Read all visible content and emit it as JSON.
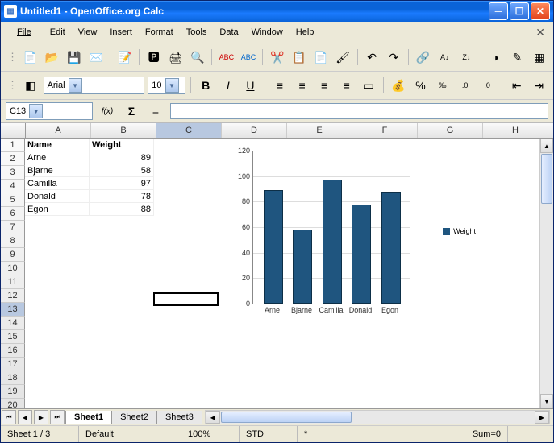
{
  "title": "Untitled1 - OpenOffice.org Calc",
  "menus": [
    "File",
    "Edit",
    "View",
    "Insert",
    "Format",
    "Tools",
    "Data",
    "Window",
    "Help"
  ],
  "font": {
    "name": "Arial",
    "size": "10"
  },
  "namebox": "C13",
  "formula_eq": "=",
  "columns": [
    "A",
    "B",
    "C",
    "D",
    "E",
    "F",
    "G",
    "H"
  ],
  "row_count": 22,
  "selected": {
    "row": 13,
    "col": 3
  },
  "table": {
    "headers": {
      "A": "Name",
      "B": "Weight"
    },
    "rows": [
      {
        "A": "Arne",
        "B": 89
      },
      {
        "A": "Bjarne",
        "B": 58
      },
      {
        "A": "Camilla",
        "B": 97
      },
      {
        "A": "Donald",
        "B": 78
      },
      {
        "A": "Egon",
        "B": 88
      }
    ]
  },
  "sheets": [
    "Sheet1",
    "Sheet2",
    "Sheet3"
  ],
  "active_sheet": 0,
  "status": {
    "sheet": "Sheet 1 / 3",
    "style": "Default",
    "zoom": "100%",
    "mode": "STD",
    "extra": "*",
    "sum": "Sum=0"
  },
  "chart_data": {
    "type": "bar",
    "categories": [
      "Arne",
      "Bjarne",
      "Camilla",
      "Donald",
      "Egon"
    ],
    "values": [
      89,
      58,
      97,
      78,
      88
    ],
    "series_name": "Weight",
    "ylim": [
      0,
      120
    ],
    "ystep": 20
  }
}
